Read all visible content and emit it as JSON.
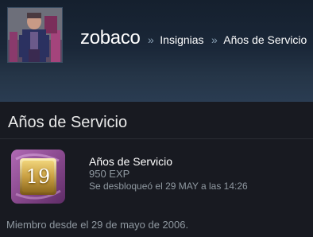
{
  "header": {
    "username": "zobaco",
    "breadcrumb_separator": "»",
    "breadcrumb_links": [
      "Insignias",
      "Años de Servicio"
    ]
  },
  "panel": {
    "title": "Años de Servicio"
  },
  "badge": {
    "level": "19",
    "name": "Años de Servicio",
    "xp": "950 EXP",
    "unlocked": "Se desbloqueó el 29 MAY a las 14:26",
    "icon": "years-of-service-badge-icon"
  },
  "member_since": "Miembro desde el 29 de mayo de 2006.",
  "colors": {
    "background": "#1b2838",
    "panel": "#181a21",
    "muted_text": "#8f98a0",
    "badge_gold": "#c9a042",
    "badge_purple": "#8a4a8f"
  }
}
